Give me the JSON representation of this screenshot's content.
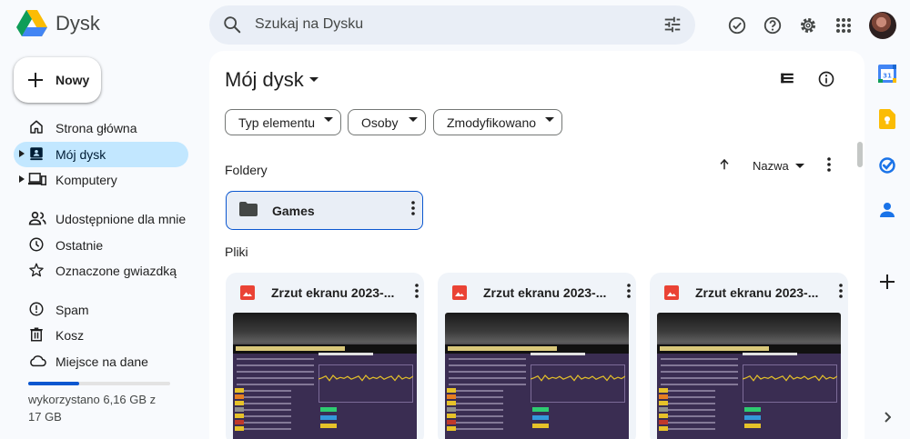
{
  "app": {
    "name": "Dysk",
    "colors": {
      "accent": "#0b57d0",
      "active_nav": "#c2e7ff",
      "background": "#f8fafd"
    }
  },
  "search": {
    "placeholder": "Szukaj na Dysku"
  },
  "header_icons": [
    "offline-ready-icon",
    "help-icon",
    "settings-icon",
    "apps-grid-icon",
    "account-avatar"
  ],
  "new_button": {
    "label": "Nowy"
  },
  "nav": {
    "items": [
      {
        "label": "Strona główna",
        "icon": "home-icon"
      },
      {
        "label": "Mój dysk",
        "icon": "my-drive-icon",
        "active": true
      },
      {
        "label": "Komputery",
        "icon": "computers-icon"
      },
      {
        "label": "Udostępnione dla mnie",
        "icon": "shared-people-icon"
      },
      {
        "label": "Ostatnie",
        "icon": "clock-icon"
      },
      {
        "label": "Oznaczone gwiazdką",
        "icon": "star-icon"
      },
      {
        "label": "Spam",
        "icon": "spam-icon"
      },
      {
        "label": "Kosz",
        "icon": "trash-icon"
      },
      {
        "label": "Miejsce na dane",
        "icon": "cloud-icon"
      }
    ]
  },
  "storage": {
    "text": "wykorzystano 6,16 GB z 17 GB",
    "used_fraction": 0.36
  },
  "main": {
    "title": "Mój dysk",
    "filters": [
      "Typ elementu",
      "Osoby",
      "Zmodyfikowano"
    ],
    "folders_label": "Foldery",
    "files_label": "Pliki",
    "sort_label": "Nazwa",
    "folders": [
      {
        "name": "Games"
      }
    ],
    "files": [
      {
        "name": "Zrzut ekranu 2023-..."
      },
      {
        "name": "Zrzut ekranu 2023-..."
      },
      {
        "name": "Zrzut ekranu 2023-..."
      }
    ]
  },
  "right_sidebar": [
    "calendar-icon",
    "keep-icon",
    "tasks-icon",
    "contacts-icon",
    "add-icon",
    "expand-panel-icon"
  ]
}
